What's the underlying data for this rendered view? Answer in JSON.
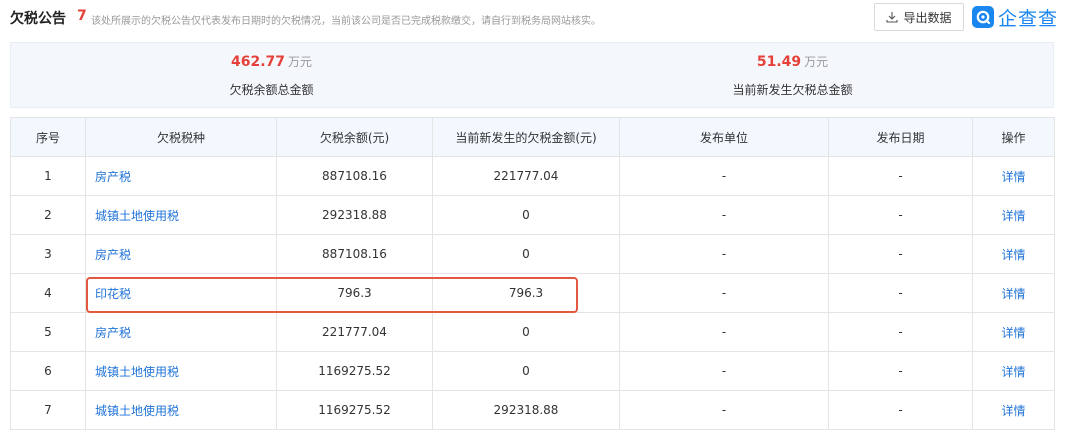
{
  "header": {
    "title": "欠税公告",
    "count": "7",
    "note": "该处所展示的欠税公告仅代表发布日期时的欠税情况，当前该公司是否已完成税款缴交，请自行到税务局网站核实。",
    "export_label": "导出数据",
    "logo_text": "企查查"
  },
  "summary": {
    "left": {
      "amount": "462.77",
      "unit": "万元",
      "label": "欠税余额总金额"
    },
    "right": {
      "amount": "51.49",
      "unit": "万元",
      "label": "当前新发生欠税总金额"
    }
  },
  "table": {
    "headers": [
      "序号",
      "欠税税种",
      "欠税余额(元)",
      "当前新发生的欠税金额(元)",
      "发布单位",
      "发布日期",
      "操作"
    ],
    "rows": [
      {
        "index": "1",
        "type": "房产税",
        "balance": "887108.16",
        "new_amount": "221777.04",
        "unit": "-",
        "date": "-",
        "action": "详情"
      },
      {
        "index": "2",
        "type": "城镇土地使用税",
        "balance": "292318.88",
        "new_amount": "0",
        "unit": "-",
        "date": "-",
        "action": "详情"
      },
      {
        "index": "3",
        "type": "房产税",
        "balance": "887108.16",
        "new_amount": "0",
        "unit": "-",
        "date": "-",
        "action": "详情"
      },
      {
        "index": "4",
        "type": "印花税",
        "balance": "796.3",
        "new_amount": "796.3",
        "unit": "-",
        "date": "-",
        "action": "详情"
      },
      {
        "index": "5",
        "type": "房产税",
        "balance": "221777.04",
        "new_amount": "0",
        "unit": "-",
        "date": "-",
        "action": "详情"
      },
      {
        "index": "6",
        "type": "城镇土地使用税",
        "balance": "1169275.52",
        "new_amount": "0",
        "unit": "-",
        "date": "-",
        "action": "详情"
      },
      {
        "index": "7",
        "type": "城镇土地使用税",
        "balance": "1169275.52",
        "new_amount": "292318.88",
        "unit": "-",
        "date": "-",
        "action": "详情"
      }
    ]
  },
  "colors": {
    "accent_red": "#e5403a",
    "link_blue": "#1f73d8",
    "brand_blue": "#1a86ef",
    "highlight_border": "#e2593f"
  },
  "icons": {
    "export": "download-icon",
    "logo": "qichacha-logo-icon"
  }
}
